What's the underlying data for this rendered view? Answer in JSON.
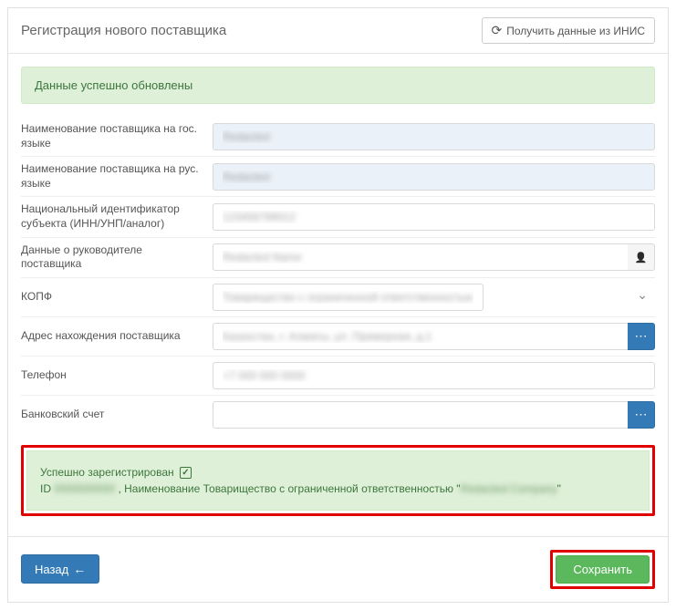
{
  "header": {
    "title": "Регистрация нового поставщика",
    "refresh_button": "Получить данные из ИНИС"
  },
  "alert_top": "Данные успешно обновлены",
  "fields": {
    "name_gov": {
      "label": "Наименование поставщика на гос. языке",
      "value": "Redacted"
    },
    "name_rus": {
      "label": "Наименование поставщика на рус. языке",
      "value": "Redacted"
    },
    "nat_id": {
      "label": "Национальный идентификатор субъекта (ИНН/УНП/аналог)",
      "value": "123456789012"
    },
    "head": {
      "label": "Данные о руководителе поставщика",
      "value": "Redacted Name"
    },
    "kopf": {
      "label": "КОПФ",
      "value": "Товарищество с ограниченной ответственностью"
    },
    "address": {
      "label": "Адрес нахождения поставщика",
      "value": "Казахстан, г. Алматы, ул. Примерная, д.1"
    },
    "phone": {
      "label": "Телефон",
      "value": "+7 000 000 0000"
    },
    "bank": {
      "label": "Банковский счет",
      "value": ""
    }
  },
  "result": {
    "line1_prefix": "Успешно зарегистрирован",
    "line2_id_label": "ID",
    "line2_id_value": "0000000000",
    "line2_mid": ", Наименование Товарищество с ограниченной ответственностью \"",
    "line2_name": "Redacted Company",
    "line2_suffix": "\""
  },
  "footer": {
    "back": "Назад",
    "save": "Сохранить"
  }
}
